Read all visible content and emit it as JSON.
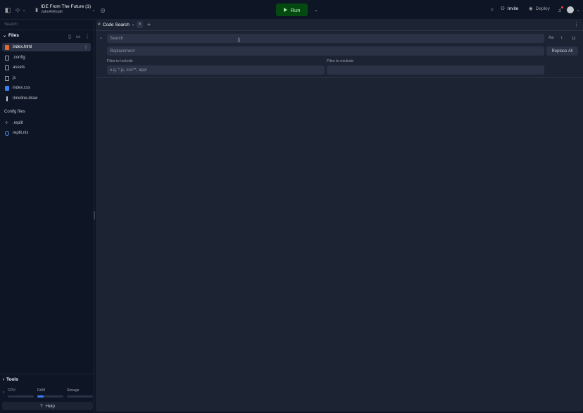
{
  "header": {
    "repl_title": "IDE From The Future (1)",
    "repl_owner": "JakeAtReplit",
    "run_label": "Run",
    "invite_label": "Invite",
    "deploy_label": "Deploy",
    "sidebar_toggle_icon": "sidebar-icon",
    "replit_logo_icon": "replit-logo",
    "search_icon": "search-icon",
    "bell_icon": "bell-icon"
  },
  "sidebar": {
    "search_placeholder": "Search",
    "files_header": "Files",
    "files": [
      {
        "name": "index.html",
        "icon": "html-file-icon",
        "active": true
      },
      {
        "name": ".config",
        "icon": "folder-icon"
      },
      {
        "name": "assets",
        "icon": "folder-icon"
      },
      {
        "name": "js",
        "icon": "folder-icon"
      },
      {
        "name": "index.css",
        "icon": "css-file-icon"
      },
      {
        "name": "timeline.draw",
        "icon": "draw-file-icon"
      }
    ],
    "config_header": "Config files",
    "config_files": [
      {
        "name": ".replit",
        "icon": "replit-file-icon"
      },
      {
        "name": "replit.nix",
        "icon": "nix-file-icon"
      }
    ],
    "tools_label": "Tools",
    "resources": {
      "cpu": "CPU",
      "ram": "RAM",
      "storage": "Storage"
    },
    "help_label": "Help"
  },
  "main": {
    "tab_label": "Code Search",
    "search_placeholder": "Search",
    "replacement_placeholder": "Replacement",
    "replace_all_label": "Replace All",
    "include_label": "Files to include",
    "include_placeholder": "e.g. *.js, src/**, app/",
    "exclude_label": "Files to exclude",
    "options": {
      "case": "Aa",
      "regex": "↕",
      "word": "⊔"
    }
  },
  "colors": {
    "background": "#0e1525",
    "panel": "#1c2333",
    "field": "#2b3245",
    "run": "#044a10"
  }
}
